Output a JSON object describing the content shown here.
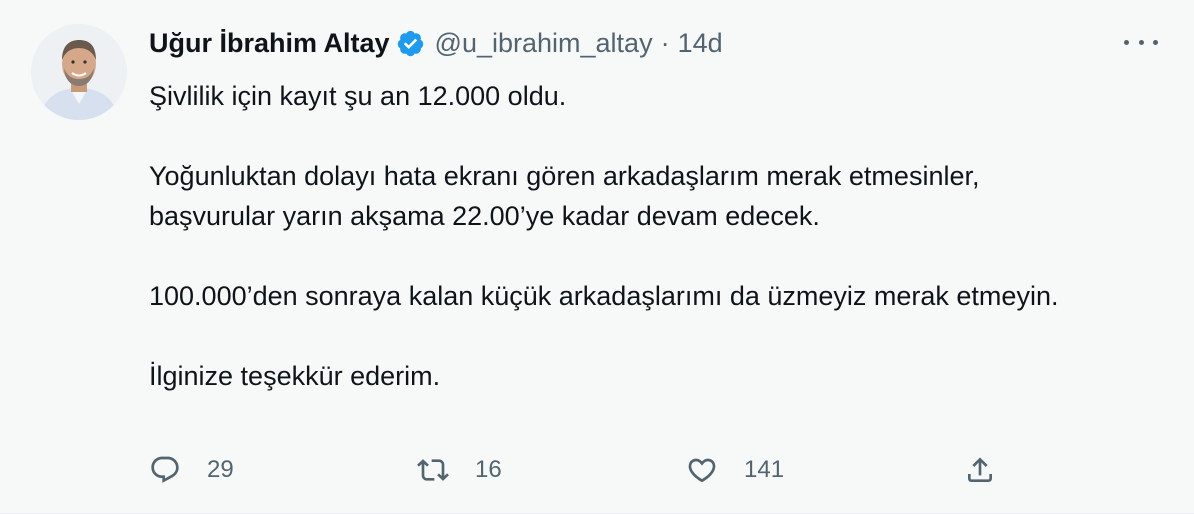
{
  "tweet": {
    "display_name": "Uğur İbrahim Altay",
    "handle": "@u_ibrahim_altay",
    "separator": "·",
    "time": "14d",
    "paragraphs": [
      "Şivlilik için kayıt şu an 12.000 oldu.",
      "Yoğunluktan dolayı hata ekranı gören arkadaşlarım merak etmesinler, başvurular yarın akşama 22.00’ye kadar devam edecek.",
      "100.000’den sonraya kalan küçük arkadaşlarımı da üzmeyiz merak etmeyin.",
      "İlginize teşekkür ederim."
    ],
    "replies": "29",
    "retweets": "16",
    "likes": "141"
  },
  "icons": {
    "verified": "verified-badge-icon",
    "more": "more-icon",
    "reply": "reply-icon",
    "retweet": "retweet-icon",
    "like": "heart-icon",
    "share": "share-icon"
  },
  "colors": {
    "accent": "#1d9bf0",
    "text": "#0f1419",
    "secondary": "#536471",
    "background": "#f7f9f9"
  }
}
